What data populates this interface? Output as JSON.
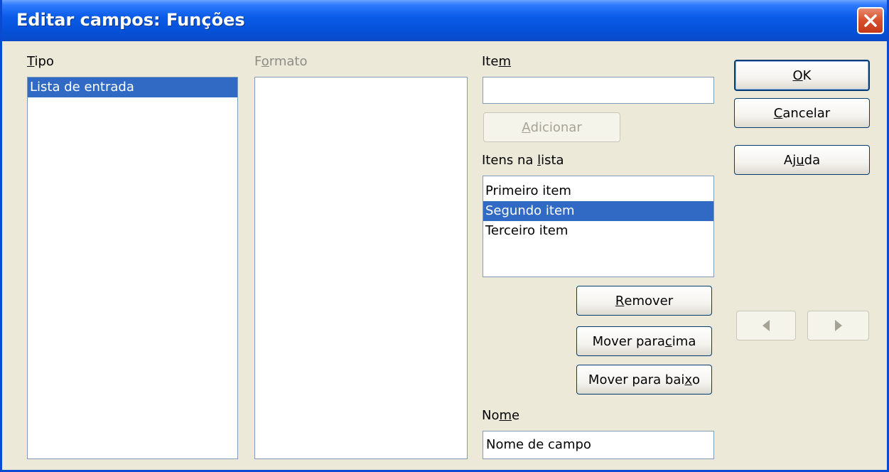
{
  "window": {
    "title": "Editar campos: Funções"
  },
  "tipo": {
    "label_mnemonic": "T",
    "label_rest": "ipo",
    "items": [
      {
        "text": "Lista de entrada",
        "selected": true
      }
    ]
  },
  "formato": {
    "label_pre": "F",
    "label_mnemonic": "o",
    "label_rest": "rmato",
    "items": []
  },
  "item": {
    "label_pre": "Ite",
    "label_mnemonic": "m",
    "value": ""
  },
  "adicionar": {
    "label_mnemonic": "A",
    "label_rest": "dicionar"
  },
  "itens_na_lista": {
    "label_pre": "Itens na ",
    "label_mnemonic": "l",
    "label_rest": "ista",
    "items": [
      {
        "text": "Primeiro item",
        "selected": false
      },
      {
        "text": "Segundo item",
        "selected": true
      },
      {
        "text": "Terceiro item",
        "selected": false
      }
    ]
  },
  "remover": {
    "label_mnemonic": "R",
    "label_rest": "emover"
  },
  "mover_cima": {
    "label_pre": "Mover para ",
    "label_mnemonic": "c",
    "label_rest": "ima"
  },
  "mover_baixo": {
    "label_pre": "Mover para bai",
    "label_mnemonic": "x",
    "label_rest": "o"
  },
  "nome": {
    "label_pre": "No",
    "label_mnemonic": "m",
    "label_rest": "e",
    "value": "Nome de campo"
  },
  "ok": {
    "label_mnemonic": "O",
    "label_rest": "K"
  },
  "cancelar": {
    "label_mnemonic": "C",
    "label_rest": "ancelar"
  },
  "ajuda": {
    "label_pre": "Aj",
    "label_mnemonic": "u",
    "label_rest": "da"
  },
  "nav": {
    "prev_icon": "triangle-left-icon",
    "next_icon": "triangle-right-icon"
  },
  "colors": {
    "titlebar": "#0551d8",
    "face": "#ece9d8",
    "selection": "#316ac5",
    "disabled_text": "#a5a396"
  }
}
